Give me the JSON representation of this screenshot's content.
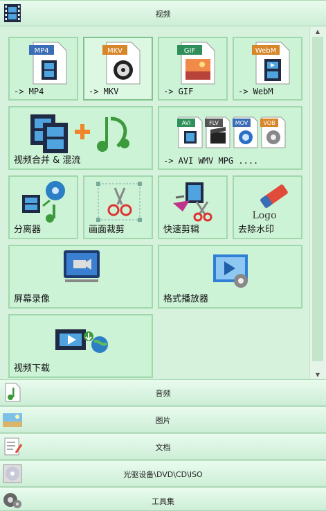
{
  "top_category": {
    "title": "视频",
    "icon": "film-icon"
  },
  "tiles": [
    {
      "label": "-> MP4",
      "badge": "MP4",
      "badge_color": "#3a6db5",
      "icon": "mp4-file-icon"
    },
    {
      "label": "-> MKV",
      "badge": "MKV",
      "badge_color": "#d8862a",
      "icon": "mkv-file-icon"
    },
    {
      "label": "-> GIF",
      "badge": "GIF",
      "badge_color": "#2f8f5a",
      "icon": "gif-file-icon"
    },
    {
      "label": "-> WebM",
      "badge": "WebM",
      "badge_color": "#d8862a",
      "icon": "webm-file-icon"
    },
    {
      "label": "视频合并 & 混流",
      "icon": "merge-video-audio-icon"
    },
    {
      "label": "-> AVI WMV MPG ....",
      "badges": [
        "AVI",
        "FLV",
        "MOV",
        "VOB"
      ],
      "icon": "multi-format-icon"
    },
    {
      "label": "分离器",
      "icon": "splitter-icon"
    },
    {
      "label": "画面裁剪",
      "icon": "crop-scissors-icon"
    },
    {
      "label": "快速剪辑",
      "icon": "quick-cut-icon"
    },
    {
      "label": "去除水印",
      "icon": "remove-watermark-icon",
      "logo_text": "Logo"
    },
    {
      "label": "屏幕录像",
      "icon": "screen-record-icon"
    },
    {
      "label": "格式播放器",
      "icon": "player-icon"
    },
    {
      "label": "视频下载",
      "icon": "video-download-icon"
    }
  ],
  "categories": [
    {
      "title": "音频",
      "icon": "audio-file-icon"
    },
    {
      "title": "图片",
      "icon": "picture-icon"
    },
    {
      "title": "文档",
      "icon": "document-icon"
    },
    {
      "title": "光驱设备\\DVD\\CD\\ISO",
      "icon": "disc-icon"
    },
    {
      "title": "工具集",
      "icon": "toolbox-icon"
    }
  ],
  "colors": {
    "tile_bg": "#cdf3d7",
    "tile_border": "#9fd8ab",
    "bar_bg": "#d9f3e0"
  }
}
